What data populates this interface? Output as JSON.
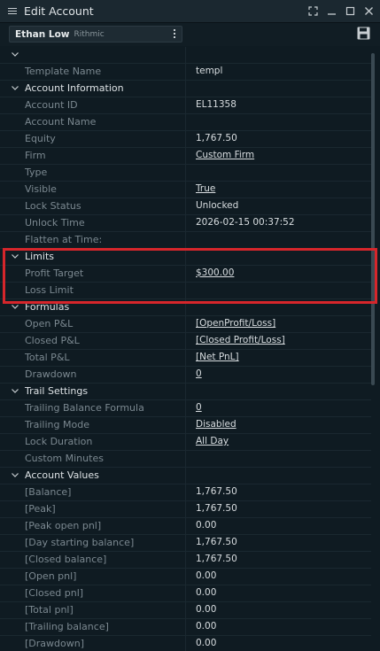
{
  "window": {
    "title": "Edit Account",
    "controls": [
      "expand-icon",
      "minimize-icon",
      "maximize-icon",
      "close-icon"
    ]
  },
  "account_selector": {
    "name": "Ethan Low",
    "sub": "Rithmic"
  },
  "tree": {
    "template": {
      "label": "Template Name",
      "value": "templ"
    },
    "account_information": {
      "title": "Account Information",
      "rows": [
        {
          "label": "Account ID",
          "value": "EL11358",
          "link": false
        },
        {
          "label": "Account Name",
          "value": "",
          "link": false
        },
        {
          "label": "Equity",
          "value": "1,767.50",
          "link": false
        },
        {
          "label": "Firm",
          "value": "Custom Firm",
          "link": true
        },
        {
          "label": "Type",
          "value": "",
          "link": false
        },
        {
          "label": "Visible",
          "value": "True",
          "link": true
        },
        {
          "label": "Lock Status",
          "value": "Unlocked",
          "link": false
        },
        {
          "label": "Unlock Time",
          "value": "2026-02-15 00:37:52",
          "link": false
        },
        {
          "label": "Flatten at Time:",
          "value": "",
          "link": false
        }
      ]
    },
    "limits": {
      "title": "Limits",
      "rows": [
        {
          "label": "Profit Target",
          "value": "$300.00",
          "link": true
        },
        {
          "label": "Loss Limit",
          "value": "",
          "link": false
        }
      ]
    },
    "formulas": {
      "title": "Formulas",
      "rows": [
        {
          "label": "Open P&L",
          "value": "[OpenProfit/Loss]",
          "link": true
        },
        {
          "label": "Closed P&L",
          "value": "[Closed Profit/Loss]",
          "link": true
        },
        {
          "label": "Total P&L",
          "value": "[Net PnL]",
          "link": true
        },
        {
          "label": "Drawdown",
          "value": "0",
          "link": true
        }
      ]
    },
    "trail_settings": {
      "title": "Trail Settings",
      "rows": [
        {
          "label": "Trailing Balance Formula",
          "value": "0",
          "link": true
        },
        {
          "label": "Trailing Mode",
          "value": "Disabled",
          "link": true
        },
        {
          "label": "Lock Duration",
          "value": "All Day",
          "link": true
        },
        {
          "label": "Custom Minutes",
          "value": "",
          "link": false
        }
      ]
    },
    "account_values": {
      "title": "Account Values",
      "rows": [
        {
          "label": "[Balance]",
          "value": "1,767.50",
          "link": false
        },
        {
          "label": "[Peak]",
          "value": "1,767.50",
          "link": false
        },
        {
          "label": "[Peak open pnl]",
          "value": "0.00",
          "link": false
        },
        {
          "label": "[Day starting balance]",
          "value": "1,767.50",
          "link": false
        },
        {
          "label": "[Closed balance]",
          "value": "1,767.50",
          "link": false
        },
        {
          "label": "[Open pnl]",
          "value": "0.00",
          "link": false
        },
        {
          "label": "[Closed pnl]",
          "value": "0.00",
          "link": false
        },
        {
          "label": "[Total pnl]",
          "value": "0.00",
          "link": false
        },
        {
          "label": "[Trailing balance]",
          "value": "0.00",
          "link": false
        },
        {
          "label": "[Drawdown]",
          "value": "0.00",
          "link": false
        }
      ]
    }
  },
  "colors": {
    "highlight": "#d6262b",
    "background": "#0f1b22"
  }
}
